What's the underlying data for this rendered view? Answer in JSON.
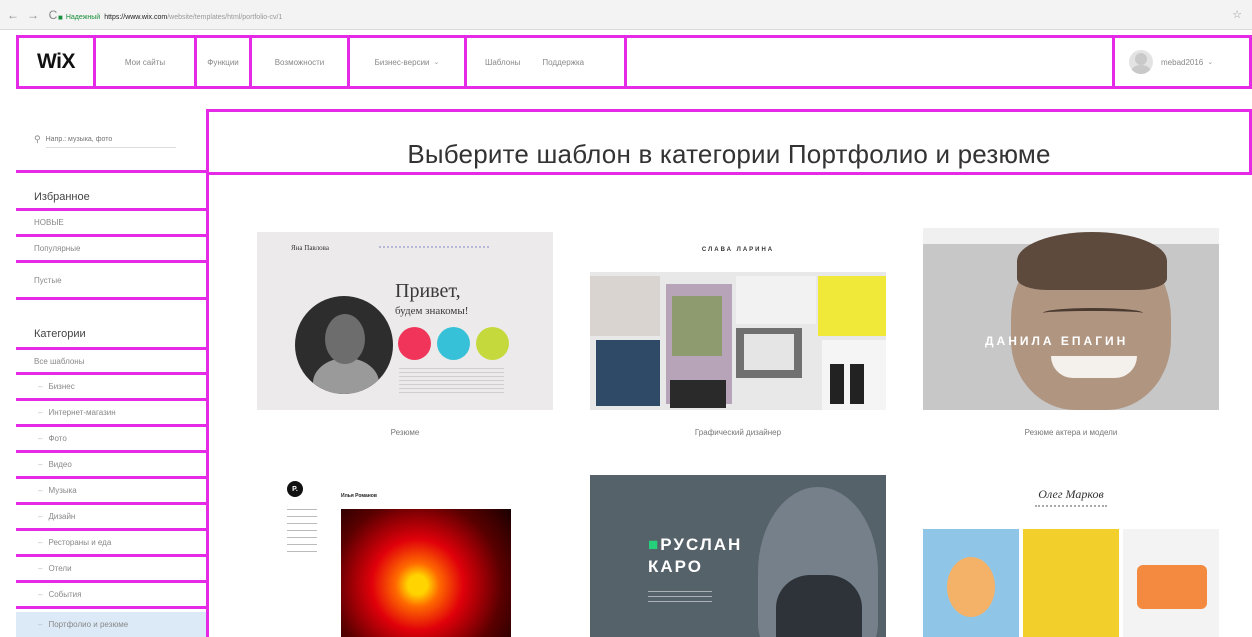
{
  "browser": {
    "back_glyph": "←",
    "forward_glyph": "→",
    "reload_glyph": "C",
    "secure_label": "Надежный",
    "url_host": "https://www.wix.com",
    "url_path": "/website/templates/html/portfolio-cv/1",
    "star_glyph": "☆"
  },
  "header": {
    "logo": "WiX",
    "nav": [
      "Мои сайты",
      "Функции",
      "Возможности",
      "Бизнес-версии",
      "Шаблоны",
      "Поддержка"
    ],
    "user_name": "mebad2016"
  },
  "sidebar": {
    "search_placeholder": "Напр.: музыка, фото",
    "favorites_heading": "Избранное",
    "favorites": [
      "НОВЫЕ",
      "Популярные",
      "Пустые"
    ],
    "categories_heading": "Категории",
    "all_templates": "Все шаблоны",
    "categories": [
      "Бизнес",
      "Интернет-магазин",
      "Фото",
      "Видео",
      "Музыка",
      "Дизайн",
      "Рестораны и еда",
      "Отели",
      "События",
      "Портфолио и резюме"
    ]
  },
  "content": {
    "title": "Выберите шаблон в категории Портфолио и резюме",
    "templates": [
      {
        "caption": "Резюме",
        "name": "Яна Павлова",
        "greeting": "Привет,",
        "greeting_sub": "будем знакомы!"
      },
      {
        "caption": "Графический дизайнер",
        "name": "СЛАВА ЛАРИНА"
      },
      {
        "caption": "Резюме актера и модели",
        "name": "ДАНИЛА ЕПАГИН"
      },
      {
        "caption": "",
        "name": "Илья Романов",
        "logo": "P."
      },
      {
        "caption": "",
        "name_a": "РУСЛАН",
        "name_b": "КАРО"
      },
      {
        "caption": "",
        "name": "Олег Марков"
      }
    ]
  },
  "colors": {
    "highlight": "#e52ae5",
    "selected_bg": "#dceaf7",
    "circle_red": "#f0345a",
    "circle_cyan": "#37c1d8",
    "circle_lime": "#c6d93c"
  }
}
